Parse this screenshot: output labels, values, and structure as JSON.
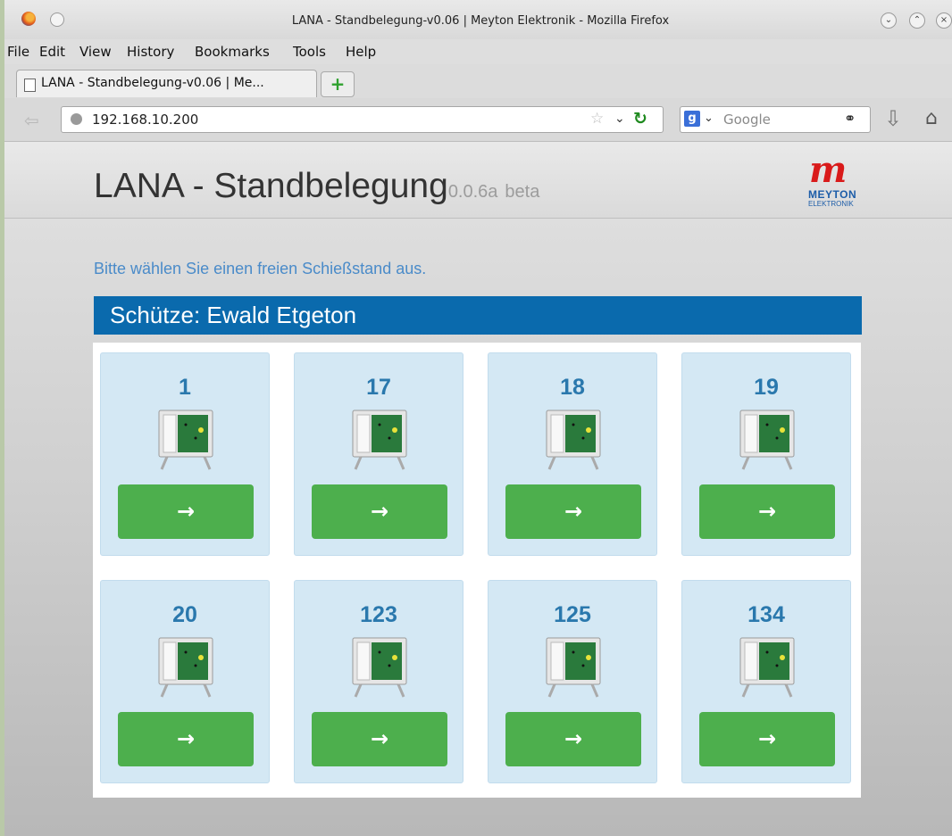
{
  "window": {
    "title": "LANA - Standbelegung-v0.06 | Meyton Elektronik - Mozilla Firefox"
  },
  "menu": [
    "File",
    "Edit",
    "View",
    "History",
    "Bookmarks",
    "Tools",
    "Help"
  ],
  "tab": {
    "title": "LANA - Standbelegung-v0.06 | Me..."
  },
  "nav": {
    "url": "192.168.10.200",
    "search_placeholder": "Google"
  },
  "header": {
    "brand": "LANA - Standbelegung",
    "version": "0.0.6a",
    "beta": "beta",
    "logo_line1": "MEYTON",
    "logo_line2": "ELEKTRONIK"
  },
  "prompt": "Bitte wählen Sie einen freien Schießstand aus.",
  "shooter": "Schütze: Ewald Etgeton",
  "stands": [
    {
      "number": "1"
    },
    {
      "number": "17"
    },
    {
      "number": "18"
    },
    {
      "number": "19"
    },
    {
      "number": "20"
    },
    {
      "number": "123"
    },
    {
      "number": "125"
    },
    {
      "number": "134"
    }
  ],
  "icons": {
    "select_arrow": "→",
    "new_tab": "+",
    "back": "⇦"
  },
  "colors": {
    "shooter_bar": "#0a6aad",
    "card_bg": "#d4e8f4",
    "button": "#4daf4d",
    "number": "#2a78ad",
    "prompt": "#4a8bc9"
  }
}
